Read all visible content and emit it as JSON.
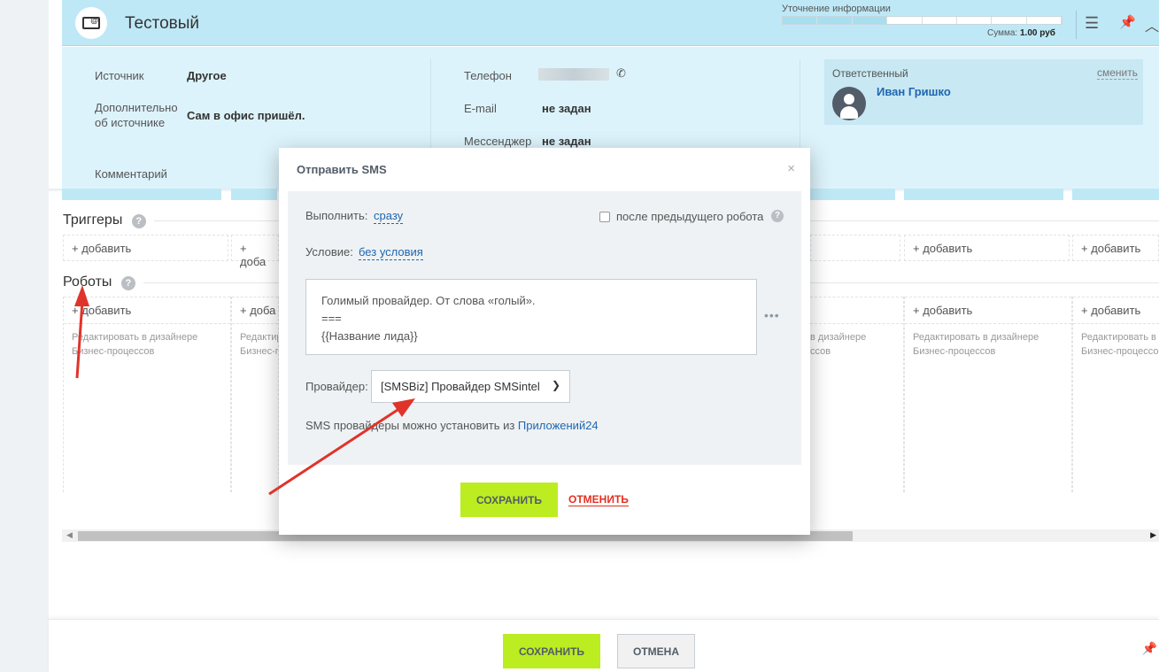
{
  "header": {
    "title": "Тестовый",
    "progress_label": "Уточнение информации",
    "progress_segments_total": 8,
    "progress_segments_filled": 3,
    "sum_label": "Сумма:",
    "sum_value": "1.00 руб"
  },
  "info": {
    "source_label": "Источник",
    "source_value": "Другое",
    "extra_source_label": "Дополнительно об источнике",
    "extra_source_value": "Сам в офис пришёл.",
    "comment_label": "Комментарий",
    "phone_label": "Телефон",
    "email_label": "E-mail",
    "email_value": "не задан",
    "messenger_label": "Мессенджер",
    "messenger_value": "не задан",
    "responsible_label": "Ответственный",
    "responsible_change": "сменить",
    "responsible_name": "Иван Гришко"
  },
  "triggers": {
    "title": "Триггеры",
    "help": "?",
    "add_labels": [
      "+ добавить",
      "+ доба",
      "+ добавить",
      "+ добавить"
    ]
  },
  "robots": {
    "title": "Роботы",
    "help": "?",
    "add_label": "+ добавить",
    "add_short": "+ доба",
    "hint": "Редактировать в дизайнере Бизнес-процессов",
    "hint_line1": "Редактировать в дизайнере",
    "hint_line2": "Бизнес-процессов",
    "hint_partial_1": "Редактир",
    "hint_partial_2": "Бизнес-п",
    "hint_tail_1": "в дизайнере",
    "hint_tail_2": "ссов",
    "hint_cut_1": "Редактировать в д",
    "hint_cut_2": "Бизнес-процессов"
  },
  "modal": {
    "title": "Отправить SMS",
    "close": "×",
    "execute_label": "Выполнить:",
    "execute_value": "сразу",
    "after_prev_label": "после предыдущего робота",
    "help": "?",
    "condition_label": "Условие:",
    "condition_value": "без условия",
    "message_line1": "Голимый провайдер. От слова «голый».",
    "message_line2": "===",
    "message_line3": "{{Название лида}}",
    "dots": "•••",
    "provider_label": "Провайдер:",
    "provider_value": "[SMSBiz] Провайдер SMSintel",
    "info_text": "SMS провайдеры можно установить из ",
    "info_link": "Приложений24",
    "save": "СОХРАНИТЬ",
    "cancel": "ОТМЕНИТЬ"
  },
  "footer": {
    "save": "СОХРАНИТЬ",
    "cancel": "ОТМЕНА"
  },
  "colors": {
    "header_bg": "#bfe8f6",
    "panel_bg": "#ddf3fb",
    "accent_green": "#bbed21",
    "link_blue": "#2067b0",
    "cancel_red": "#e52e1f",
    "annotation_arrow": "#e0332b"
  }
}
